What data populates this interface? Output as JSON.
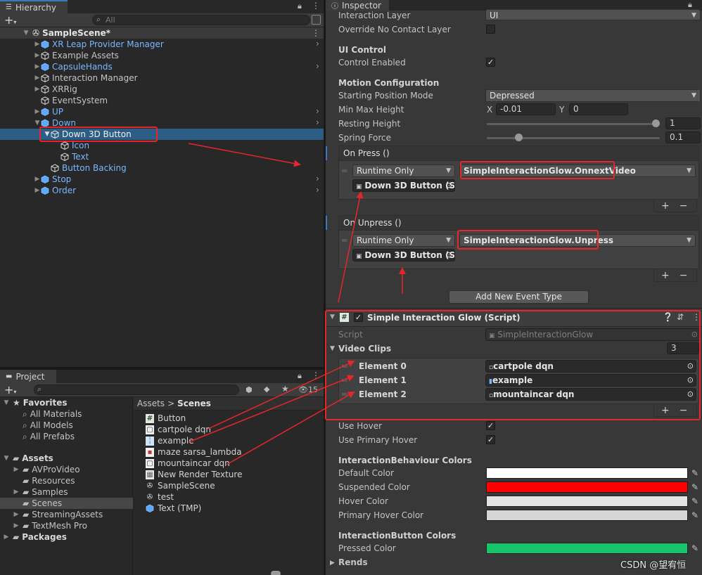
{
  "hierarchy": {
    "tab_label": "Hierarchy",
    "search_placeholder": "All",
    "scene": "SampleScene*",
    "items": [
      {
        "label": "XR Leap Provider Manager"
      },
      {
        "label": "Example Assets"
      },
      {
        "label": "CapsuleHands"
      },
      {
        "label": "Interaction Manager"
      },
      {
        "label": "XRRig"
      },
      {
        "label": "EventSystem"
      },
      {
        "label": "UP"
      },
      {
        "label": "Down"
      },
      {
        "label": "Down 3D Button"
      },
      {
        "label": "Icon"
      },
      {
        "label": "Text"
      },
      {
        "label": "Button Backing"
      },
      {
        "label": "Stop"
      },
      {
        "label": "Order"
      }
    ]
  },
  "project": {
    "tab_label": "Project",
    "hidden_count": "15",
    "favorites_label": "Favorites",
    "favorites": [
      "All Materials",
      "All Models",
      "All Prefabs"
    ],
    "assets_label": "Assets",
    "folders": [
      "AVProVideo",
      "Resources",
      "Samples",
      "Scenes",
      "StreamingAssets",
      "TextMesh Pro"
    ],
    "packages_label": "Packages",
    "breadcrumb": {
      "root": "Assets",
      "sep": ">",
      "current": "Scenes"
    },
    "files": [
      "Button",
      "cartpole dqn",
      "example",
      "maze sarsa_lambda",
      "mountaincar dqn",
      "New Render Texture",
      "SampleScene",
      "test",
      "Text (TMP)"
    ]
  },
  "inspector": {
    "tab_label": "Inspector",
    "interaction_layer_label": "Interaction Layer",
    "interaction_layer_value": "UI",
    "override_label": "Override No Contact Layer",
    "ui_control_header": "UI Control",
    "control_enabled_label": "Control Enabled",
    "motion_header": "Motion Configuration",
    "starting_position_label": "Starting Position Mode",
    "starting_position_value": "Depressed",
    "minmax_label": "Min Max Height",
    "min_x_label": "X",
    "min_x_value": "-0.01",
    "max_y_label": "Y",
    "max_y_value": "0",
    "resting_label": "Resting Height",
    "resting_value": "1",
    "resting_fraction": 1.0,
    "spring_label": "Spring Force",
    "spring_value": "0.1",
    "spring_fraction": 0.1,
    "on_press": {
      "header": "On Press ()",
      "runtime": "Runtime Only",
      "function": "SimpleInteractionGlow.OnnextVideo",
      "target": "Down 3D Button (S"
    },
    "on_unpress": {
      "header": "On Unpress ()",
      "runtime": "Runtime Only",
      "function": "SimpleInteractionGlow.Unpress",
      "target": "Down 3D Button (S"
    },
    "add_event_type": "Add New Event Type",
    "component": {
      "title": "Simple Interaction Glow (Script)",
      "script_label": "Script",
      "script_value": "SimpleInteractionGlow",
      "video_clips_label": "Video Clips",
      "video_clips_count": "3",
      "elements": [
        {
          "label": "Element 0",
          "value": "cartpole dqn"
        },
        {
          "label": "Element 1",
          "value": "example"
        },
        {
          "label": "Element 2",
          "value": "mountaincar dqn"
        }
      ],
      "use_hover_label": "Use Hover",
      "use_primary_hover_label": "Use Primary Hover",
      "behaviour_colors_header": "InteractionBehaviour Colors",
      "default_color_label": "Default Color",
      "suspended_color_label": "Suspended Color",
      "hover_color_label": "Hover Color",
      "primary_hover_color_label": "Primary Hover Color",
      "button_colors_header": "InteractionButton Colors",
      "pressed_color_label": "Pressed Color",
      "rends_label": "Rends"
    }
  },
  "colors": {
    "default_color": "#ffffff",
    "suspended_color": "#ff0000",
    "hover_color": "#e3e3e3",
    "primary_hover_color": "#d6d6d6",
    "pressed_color": "#16c46a",
    "accent": "#3a79bb",
    "highlight": "#e5262c"
  },
  "watermark": "CSDN @望宥恒"
}
